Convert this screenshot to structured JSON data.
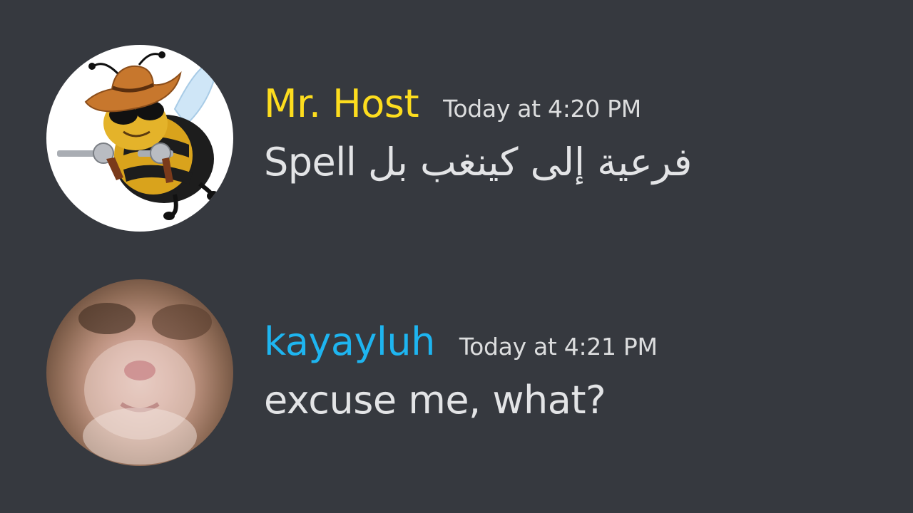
{
  "messages": [
    {
      "author": "Mr. Host",
      "author_color": "#fddd1e",
      "timestamp": "Today at 4:20 PM",
      "text": "Spell فرعية إلى كينغب بل",
      "avatar_icon": "cowboy-bee-avatar"
    },
    {
      "author": "kayayluh",
      "author_color": "#1eb5f0",
      "timestamp": "Today at 4:21 PM",
      "text": "excuse me, what?",
      "avatar_icon": "hamster-avatar"
    }
  ],
  "colors": {
    "background": "#36393f",
    "message_text": "#e3e4e6",
    "timestamp": "#dcddde"
  }
}
